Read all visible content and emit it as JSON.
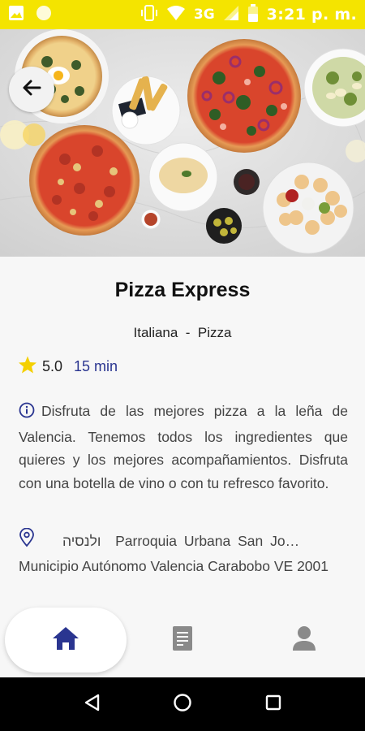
{
  "status_bar": {
    "time": "3:21 p. m.",
    "network": "3G",
    "icons": [
      "image-icon",
      "circle-icon",
      "vibrate-icon",
      "wifi-icon",
      "signal-icon",
      "battery-icon"
    ]
  },
  "hero": {
    "image": "pizza-table-photo",
    "back_icon": "arrow-left-icon"
  },
  "restaurant": {
    "name": "Pizza Express",
    "categories": "Italiana  -  Pizza",
    "rating": "5.0",
    "delivery_time": "15 min",
    "description": "Disfruta de las mejores pizza a la leña de Valencia. Tenemos todos los ingredientes que quieres y los mejores acompañamientos. Disfruta con una botella de vino o con tu refresco favorito.",
    "address_line1": "ולנסיה  Parroquia Urbana San Jo…",
    "address_line2": "Municipio Autónomo Valencia Carabobo VE 2001"
  },
  "bottom_nav": {
    "items": [
      {
        "icon": "home-icon",
        "active": true
      },
      {
        "icon": "receipt-icon",
        "active": false
      },
      {
        "icon": "person-icon",
        "active": false
      }
    ]
  },
  "colors": {
    "status_bar": "#f4e400",
    "accent": "#2a3590",
    "star": "#f4d000",
    "icon_gray": "#8a8a8a"
  }
}
